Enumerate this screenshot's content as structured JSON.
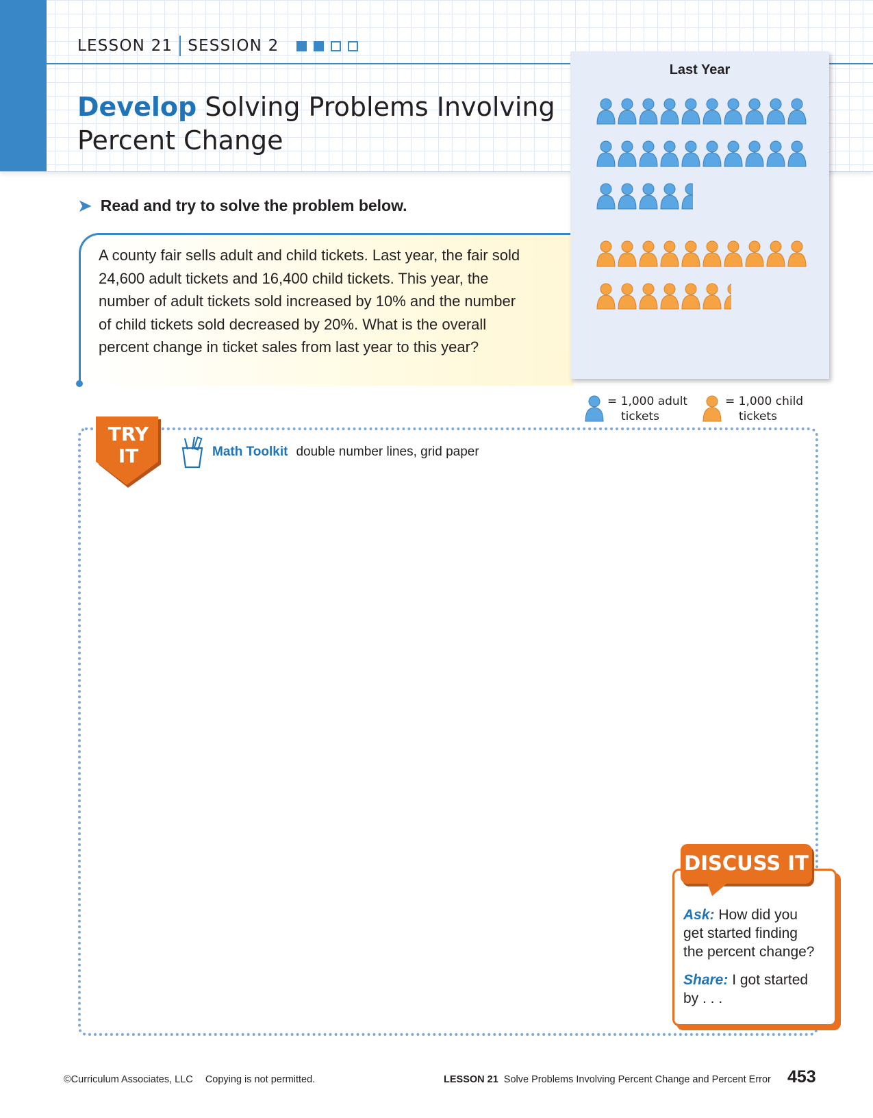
{
  "header": {
    "lesson": "LESSON 21",
    "session": "SESSION 2",
    "progress": {
      "filled": 2,
      "total": 4
    },
    "title_keyword": "Develop",
    "title_line1_rest": "Solving Problems Involving",
    "title_line2": "Percent Change"
  },
  "instruction": "Read and try to solve the problem below.",
  "problem": "A county fair sells adult and child tickets. Last year, the fair sold 24,600 adult tickets and 16,400 child tickets. This year, the number of adult tickets sold increased by 10% and the number of child tickets sold decreased by 20%. What is the overall percent change in ticket sales from last year to this year?",
  "pictograph": {
    "title": "Last Year",
    "adult_rows": [
      10,
      10,
      4.6
    ],
    "child_rows": [
      10,
      6.4
    ],
    "adult_color": "#5aa7e3",
    "child_color": "#f5a343",
    "legend_adult": "= 1,000 adult tickets",
    "legend_child": "= 1,000 child tickets",
    "legend_adult_line1": "= 1,000 adult",
    "legend_adult_line2": "tickets",
    "legend_child_line1": "= 1,000 child",
    "legend_child_line2": "tickets"
  },
  "try_it": {
    "badge_line1": "TRY",
    "badge_line2": "IT",
    "toolkit_label": "Math Toolkit",
    "toolkit_items": "double number lines, grid paper"
  },
  "discuss": {
    "title": "DISCUSS IT",
    "ask_label": "Ask:",
    "ask_text": "How did you get started finding the percent change?",
    "share_label": "Share:",
    "share_text": "I got started by . . ."
  },
  "footer": {
    "copyright": "©Curriculum Associates, LLC",
    "copy_notice": "Copying is not permitted.",
    "lesson_label": "LESSON 21",
    "lesson_title": "Solve Problems Involving Percent Change and Percent Error",
    "page_number": "453"
  },
  "colors": {
    "brand_blue": "#3a87c8",
    "title_blue": "#1f73b7",
    "accent_orange": "#e8711f"
  },
  "icons": [
    "arrow-right-icon",
    "person-adult-icon",
    "person-child-icon",
    "toolkit-cup-icon"
  ]
}
